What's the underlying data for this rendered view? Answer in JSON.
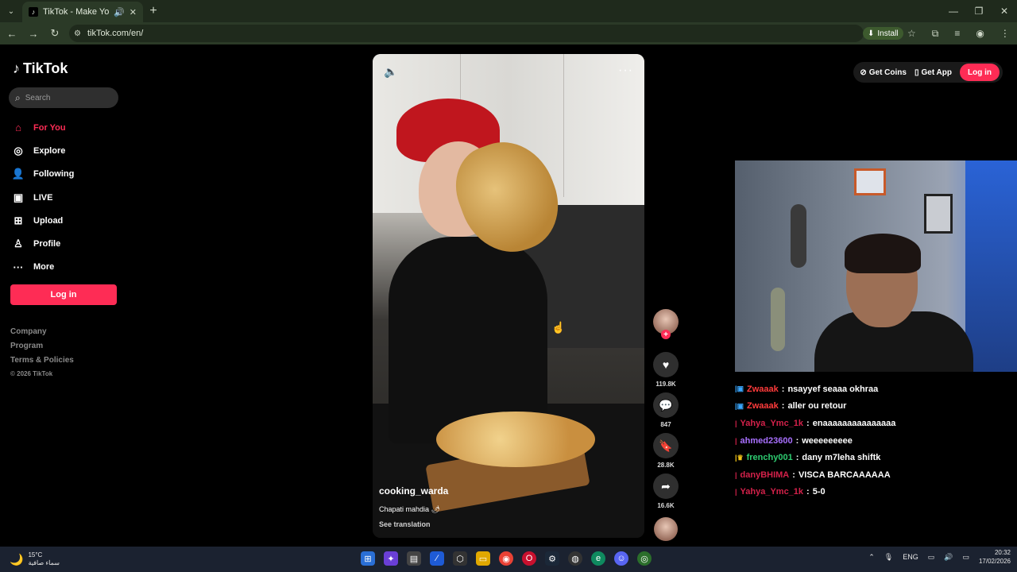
{
  "browser": {
    "tab_title": "TikTok - Make Your Day",
    "url": "tikTok.com/en/",
    "install_label": "Install",
    "icons": [
      "tab-list-icon",
      "tiktok-favicon",
      "speaker-icon",
      "close-icon",
      "new-tab-icon",
      "minimize-icon",
      "restore-icon",
      "window-close-icon",
      "back-icon",
      "forward-icon",
      "reload-icon",
      "site-info-icon",
      "star-icon",
      "extensions-icon",
      "media-icon",
      "profile-icon",
      "menu-icon"
    ]
  },
  "sidebar": {
    "logo": "TikTok",
    "search_placeholder": "Search",
    "nav": [
      {
        "label": "For You",
        "icon": "home-icon",
        "active": true
      },
      {
        "label": "Explore",
        "icon": "compass-icon"
      },
      {
        "label": "Following",
        "icon": "following-icon"
      },
      {
        "label": "LIVE",
        "icon": "live-icon"
      },
      {
        "label": "Upload",
        "icon": "upload-icon"
      },
      {
        "label": "Profile",
        "icon": "profile-icon"
      },
      {
        "label": "More",
        "icon": "more-icon"
      }
    ],
    "login_label": "Log in",
    "footer": [
      "Company",
      "Program",
      "Terms & Policies"
    ],
    "copyright": "© 2026 TikTok"
  },
  "video": {
    "author": "cooking_warda",
    "caption": "Chapati mahdia 🌶",
    "see_translation": "See translation"
  },
  "actions": {
    "likes": "119.8K",
    "comments": "847",
    "saves": "28.8K",
    "shares": "16.6K"
  },
  "topbar": {
    "get_coins": "Get Coins",
    "get_app": "Get App",
    "login": "Log in"
  },
  "chat": [
    {
      "user": "Zwaaak",
      "color": "#ff3b3b",
      "text": "nsayyef seaaa okhraa",
      "badge": "|▣"
    },
    {
      "user": "Zwaaak",
      "color": "#ff3b3b",
      "text": "aller ou retour",
      "badge": "|▣"
    },
    {
      "user": "Yahya_Ymc_1k",
      "color": "#d4214a",
      "text": "enaaaaaaaaaaaaaaa",
      "badge": "|"
    },
    {
      "user": "ahmed23600",
      "color": "#a970ff",
      "text": "weeeeeeeee",
      "badge": "|"
    },
    {
      "user": "frenchy001",
      "color": "#2ecc71",
      "text": "dany m7leha shiftk",
      "badge": "|♛"
    },
    {
      "user": "danyBHIMA",
      "color": "#d4214a",
      "text": "VISCA BARCAAAAAA",
      "badge": "|"
    },
    {
      "user": "Yahya_Ymc_1k",
      "color": "#d4214a",
      "text": "5-0",
      "badge": "|"
    }
  ],
  "taskbar": {
    "temp": "15°C",
    "weather_text": "سماء صافية",
    "lang": "ENG",
    "time": "20:32",
    "date": "17/02/2026"
  }
}
